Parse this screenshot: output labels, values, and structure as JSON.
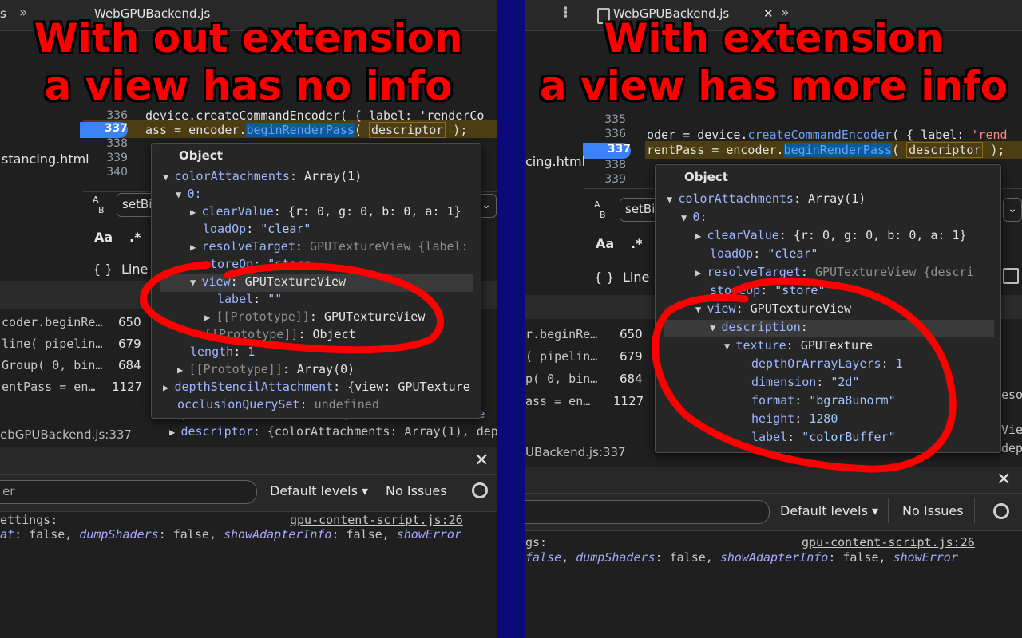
{
  "left": {
    "tab_name": "WebGPUBackend.js",
    "tab_prefix": "s",
    "caption_line1": "With out extension",
    "caption_line2": "a view has no info",
    "lines": [
      "336",
      "337",
      "338",
      "339",
      "340"
    ],
    "code_336": "device.createCommandEncoder( { label: 'renderCo",
    "code_337_a": "ass = encoder.",
    "code_337_fn": "beginRenderPass",
    "code_337_b": "( ",
    "code_337_arg": "descriptor",
    "code_337_c": " );",
    "file_label": "stancing.html",
    "search_value": "setBi",
    "aa_label": "Aa",
    "regex_label": ".*",
    "line_label": "Line",
    "braces_label": "{ }",
    "calls": [
      {
        "text": "coder.beginRe…",
        "num": "650"
      },
      {
        "text": "line( pipelin…",
        "num": "679"
      },
      {
        "text": "Group( 0, bin…",
        "num": "684"
      },
      {
        "text": "entPass = en…",
        "num": "1127"
      }
    ],
    "scope_bg_1": "depthStencilAttachment: {view: GPUTextureVie",
    "scope_descriptor_key": "descriptor",
    "scope_descriptor_val": "{colorAttachments: Array(1), dep",
    "location": "ebGPUBackend.js:337",
    "filter_placeholder": "er",
    "default_levels": "Default levels ▾",
    "no_issues": "No Issues",
    "log_title": "ettings:",
    "log_link": "gpu-content-script.js:26",
    "log_body_a": "at",
    "log_body_b": ": false, ",
    "log_dump": "dumpShaders",
    "log_adapter": "showAdapterInfo",
    "log_error": "showError",
    "popup": {
      "header": "Object",
      "color_attachments_key": "colorAttachments",
      "color_attachments_val": "Array(1)",
      "index0": "0:",
      "clear_key": "clearValue",
      "clear_val": "{r: 0, g: 0, b: 0, a: 1}",
      "load_key": "loadOp",
      "load_val": "\"clear\"",
      "resolve_key": "resolveTarget",
      "resolve_val": "GPUTextureView {label:",
      "store_key": "storeOp",
      "store_val": "\"store",
      "view_key": "view",
      "view_val": "GPUTextureView",
      "label_key": "label",
      "label_val": "\"\"",
      "proto_key": "[[Prototype]]",
      "proto_val": "GPUTextureView",
      "proto2_key": "[[Prototype]]",
      "proto2_val": "Object",
      "length_key": "length",
      "length_val": "1",
      "proto3_key": "[[Prototype]]",
      "proto3_val": "Array(0)",
      "depth_key": "depthStencilAttachment",
      "depth_val": "{view: GPUTexture",
      "occlusion_key": "occlusionQuerySet",
      "occlusion_val": "undefined"
    }
  },
  "right": {
    "tab_name": "WebGPUBackend.js",
    "caption_line1": "With extension",
    "caption_line2": "a view has more info",
    "lines": [
      "335",
      "336",
      "337",
      "338",
      "339"
    ],
    "code_336_a": "oder = device.",
    "code_336_fn": "createCommandEncoder",
    "code_336_b": "( { label: ",
    "code_336_str": "'rend",
    "code_337_a": "rentPass = encoder.",
    "code_337_fn": "beginRenderPass",
    "code_337_b": "( ",
    "code_337_arg": "descriptor",
    "code_337_c": " );",
    "file_label": "cing.html",
    "search_value": "setBi",
    "aa_label": "Aa",
    "regex_label": ".*",
    "line_label": "Line",
    "braces_label": "{ }",
    "calls": [
      {
        "text": "r.beginRe…",
        "num": "650"
      },
      {
        "text": "( pipelin…",
        "num": "679"
      },
      {
        "text": "p( 0, bin…",
        "num": "684"
      },
      {
        "text": "ass = en…",
        "num": "1127"
      }
    ],
    "location": "UBackend.js:337",
    "default_levels": "Default levels ▾",
    "no_issues": "No Issues",
    "log_title": "gs:",
    "log_link": "gpu-content-script.js:26",
    "log_body_a": "false",
    "log_dump": "dumpShaders",
    "log_adapter": "showAdapterInfo",
    "log_error": "showError",
    "side_1": "eso",
    "side_2": "Vie",
    "side_3": "dep",
    "popup": {
      "header": "Object",
      "color_attachments_key": "colorAttachments",
      "color_attachments_val": "Array(1)",
      "index0": "0:",
      "clear_key": "clearValue",
      "clear_val": "{r: 0, g: 0, b: 0, a: 1}",
      "load_key": "loadOp",
      "load_val": "\"clear\"",
      "resolve_key": "resolveTarget",
      "resolve_val": "GPUTextureView {descri",
      "store_key": "storeOp",
      "store_val": "\"store\"",
      "view_key": "view",
      "view_val": "GPUTextureView",
      "description_key": "description",
      "texture_key": "texture",
      "texture_val": "GPUTexture",
      "depth_key": "depthOrArrayLayers",
      "depth_val": "1",
      "dimension_key": "dimension",
      "dimension_val": "\"2d\"",
      "format_key": "format",
      "format_val": "\"bgra8unorm\"",
      "height_key": "height",
      "height_val": "1280",
      "label_key": "label",
      "label_val": "\"colorBuffer\""
    }
  },
  "colors": {
    "divider": "#0a0a7a",
    "annotation": "#ff0000",
    "active_line": "#3b82f6",
    "paused_line_bg": "#4d3d12"
  },
  "icons": [
    "close-icon",
    "gear-icon",
    "kebab-menu-icon",
    "chevron-double-icon",
    "file-icon",
    "case-sensitive-icon",
    "regex-icon",
    "dropdown-chevron-icon"
  ]
}
